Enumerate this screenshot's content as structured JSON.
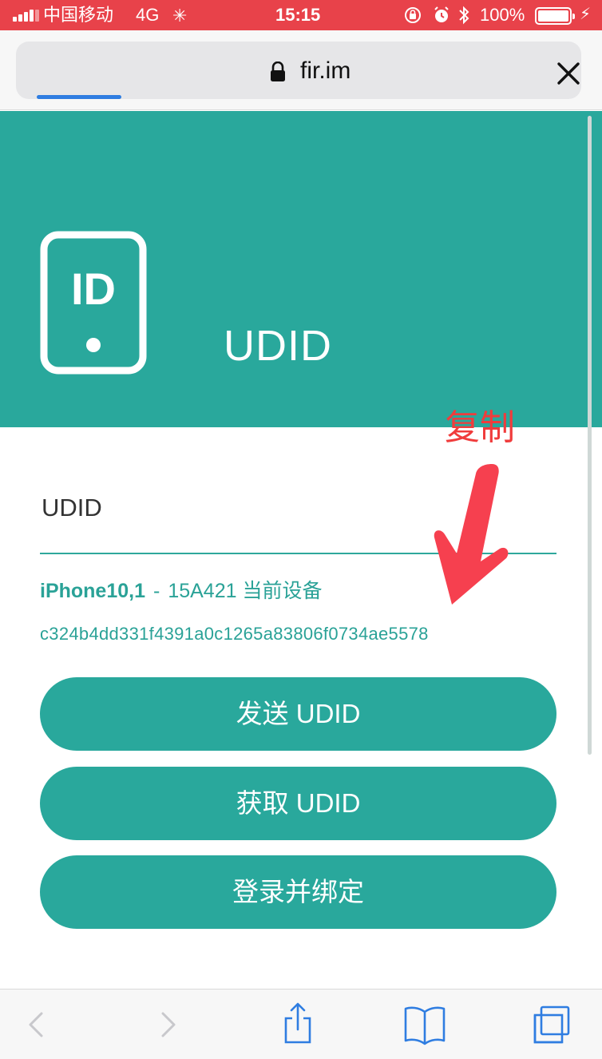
{
  "status_bar": {
    "carrier": "中国移动",
    "network": "4G",
    "time": "15:15",
    "battery_percent": "100%",
    "battery_level": 1.0
  },
  "browser": {
    "url": "fir.im",
    "page_load_progress": 0.15
  },
  "hero": {
    "icon_text": "ID",
    "title": "UDID"
  },
  "content": {
    "section_title": "UDID",
    "device_model": "iPhone10,1",
    "separator": "-",
    "device_build": "15A421 当前设备",
    "udid_value": "c324b4dd331f4391a0c1265a83806f0734ae5578"
  },
  "buttons": {
    "send": "发送 UDID",
    "get": "获取 UDID",
    "login_bind": "登录并绑定"
  },
  "annotation": {
    "text": "复制"
  },
  "colors": {
    "accent_teal": "#29a89c",
    "status_bar_red": "#e8424a",
    "annotation_red": "#f03c3c",
    "ios_blue": "#2f7de1"
  },
  "icons": {
    "lock": "lock-icon",
    "close": "close-icon",
    "back": "chevron-left-icon",
    "forward": "chevron-right-icon",
    "share": "share-icon",
    "bookmarks": "book-icon",
    "tabs": "tabs-icon"
  }
}
